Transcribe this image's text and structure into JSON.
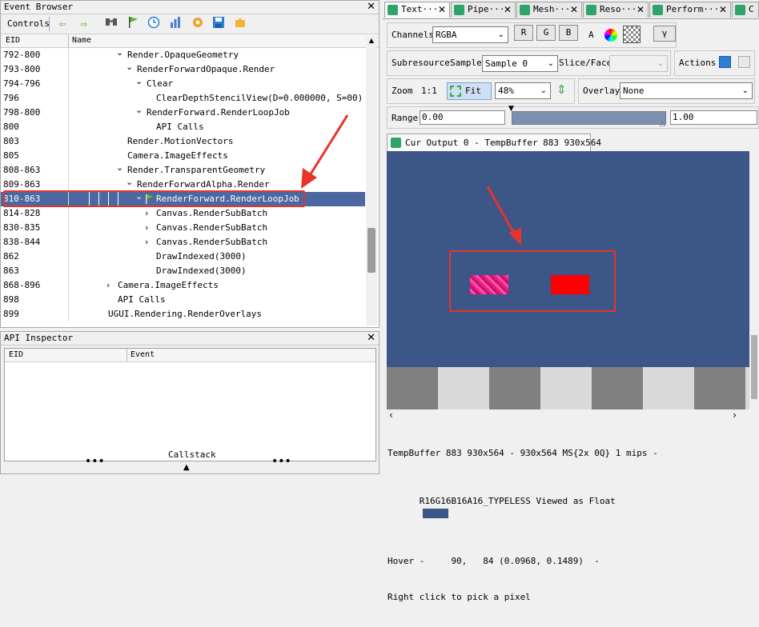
{
  "event_browser": {
    "title": "Event Browser",
    "controls_label": "Controls",
    "col_eid": "EID",
    "col_name": "Name",
    "rows": [
      {
        "eid": "792-800",
        "name": "Render.OpaqueGeometry",
        "indent": 0,
        "chev": "v"
      },
      {
        "eid": "793-800",
        "name": "RenderForwardOpaque.Render",
        "indent": 1,
        "chev": "v"
      },
      {
        "eid": "794-796",
        "name": "Clear",
        "indent": 2,
        "chev": "v"
      },
      {
        "eid": "796",
        "name": "ClearDepthStencilView(D=0.000000, S=00)",
        "indent": 3,
        "chev": ""
      },
      {
        "eid": "798-800",
        "name": "RenderForward.RenderLoopJob",
        "indent": 2,
        "chev": "v"
      },
      {
        "eid": "800",
        "name": "API Calls",
        "indent": 3,
        "chev": ""
      },
      {
        "eid": "803",
        "name": "Render.MotionVectors",
        "indent": 0,
        "chev": ""
      },
      {
        "eid": "805",
        "name": "Camera.ImageEffects",
        "indent": 0,
        "chev": ""
      },
      {
        "eid": "808-863",
        "name": "Render.TransparentGeometry",
        "indent": 0,
        "chev": "v"
      },
      {
        "eid": "809-863",
        "name": "RenderForwardAlpha.Render",
        "indent": 1,
        "chev": "v"
      },
      {
        "eid": "810-863",
        "name": "RenderForward.RenderLoopJob",
        "indent": 2,
        "chev": "v",
        "selected": true
      },
      {
        "eid": "814-828",
        "name": "Canvas.RenderSubBatch",
        "indent": 3,
        "chev": ">"
      },
      {
        "eid": "830-835",
        "name": "Canvas.RenderSubBatch",
        "indent": 3,
        "chev": ">"
      },
      {
        "eid": "838-844",
        "name": "Canvas.RenderSubBatch",
        "indent": 3,
        "chev": ">"
      },
      {
        "eid": "862",
        "name": "DrawIndexed(3000)",
        "indent": 3,
        "chev": ""
      },
      {
        "eid": "863",
        "name": "DrawIndexed(3000)",
        "indent": 3,
        "chev": ""
      },
      {
        "eid": "868-896",
        "name": "Camera.ImageEffects",
        "indent": -1,
        "chev": ">"
      },
      {
        "eid": "898",
        "name": "API Calls",
        "indent": -1,
        "chev": ""
      },
      {
        "eid": "899",
        "name": "UGUI.Rendering.RenderOverlays",
        "indent": -2,
        "chev": ""
      }
    ]
  },
  "api_inspector": {
    "title": "API Inspector",
    "col_eid": "EID",
    "col_event": "Event",
    "callstack_label": "Callstack",
    "dots": "•••"
  },
  "tabs": [
    {
      "label": "Text···",
      "active": true
    },
    {
      "label": "Pipe···",
      "active": false
    },
    {
      "label": "Mesh···",
      "active": false
    },
    {
      "label": "Reso···",
      "active": false
    },
    {
      "label": "Perform···",
      "active": false
    },
    {
      "label": "C",
      "active": false
    }
  ],
  "texture_viewer": {
    "channels_label": "Channels",
    "channels_value": "RGBA",
    "r": "R",
    "g": "G",
    "b": "B",
    "a": "A",
    "gamma_label": "γ",
    "subresource_label": "Subresource",
    "sample_label": "Sample",
    "sample_value": "Sample 0",
    "slice_label": "Slice/Face",
    "actions_label": "Actions",
    "zoom_label": "Zoom",
    "zoom_1to1": "1:1",
    "fit_label": "Fit",
    "zoom_value": "48%",
    "overlay_label": "Overlay",
    "overlay_value": "None",
    "range_label": "Range",
    "range_min": "0.00",
    "range_max": "1.00",
    "output_tab": "Cur Output 0 - TempBuffer 883 930x564",
    "status_line1": "TempBuffer 883 930x564 - 930x564 MS{2x 0Q} 1 mips -",
    "status_line2": "R16G16B16A16_TYPELESS Viewed as Float",
    "status_line3": "Hover -     90,   84 (0.0968, 0.1489)  -",
    "status_line4": "Right click to pick a pixel"
  },
  "colors": {
    "selection": "#4b68a0",
    "canvas_bg": "#3b5687",
    "highlight_red": "#e8332a",
    "swatch": "#3b5687"
  }
}
